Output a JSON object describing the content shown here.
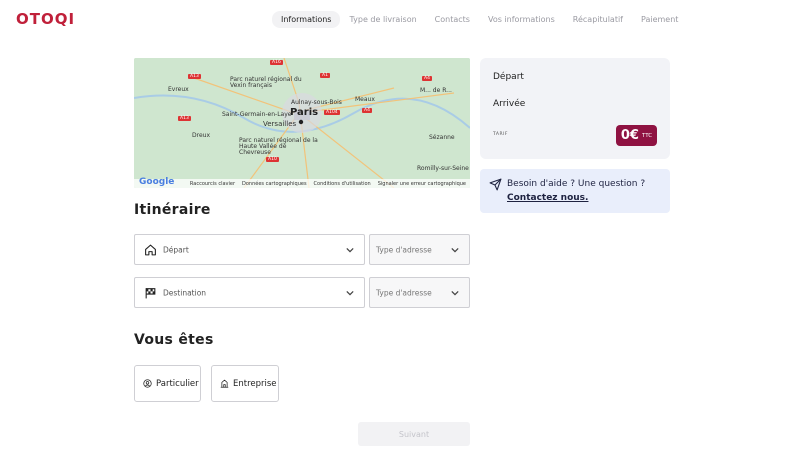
{
  "app": {
    "logo": "OTOQI",
    "brand_color": "#c0203a"
  },
  "steps": [
    {
      "label": "Informations",
      "active": true
    },
    {
      "label": "Type de livraison",
      "active": false
    },
    {
      "label": "Contacts",
      "active": false
    },
    {
      "label": "Vos informations",
      "active": false
    },
    {
      "label": "Récapitulatif",
      "active": false
    },
    {
      "label": "Paiement",
      "active": false
    }
  ],
  "map": {
    "labels": {
      "paris": "Paris",
      "versailles": "Versailles",
      "evreux": "Evreux",
      "dreux": "Dreux",
      "saint_germain": "Saint-Germain-en-Laye",
      "pnr_vexin": "Parc naturel régional du Vexin français",
      "aulnay": "Aulnay-sous-Bois",
      "meaux": "Meaux",
      "pnr_chevreuse": "Parc naturel régional de la Haute Vallée de Chevreuse",
      "sezanne": "Sézanne",
      "romilly": "Romilly-sur-Seine",
      "marne": "M... de R..."
    },
    "roads": [
      "A13",
      "A16",
      "A1",
      "A4",
      "A4",
      "A104",
      "A13",
      "A10"
    ],
    "google": "Google",
    "footer": {
      "shortcuts": "Raccourcis clavier",
      "map_data": "Données cartographiques",
      "terms": "Conditions d'utilisation",
      "report": "Signaler une erreur cartographique"
    }
  },
  "summary": {
    "depart": "Départ",
    "arrivee": "Arrivée",
    "tarif": "TARIF",
    "price": "0€",
    "ttc": "TTC",
    "price_color": "#8f1242"
  },
  "help": {
    "question": "Besoin d'aide ? Une question ?",
    "link": "Contactez nous."
  },
  "itinerary": {
    "title": "Itinéraire",
    "depart_label": "Départ",
    "destination_label": "Destination",
    "type_placeholder": "Type d'adresse"
  },
  "vous_etes": {
    "title": "Vous êtes",
    "particulier": "Particulier",
    "entreprise": "Entreprise"
  },
  "next_button": "Suivant"
}
